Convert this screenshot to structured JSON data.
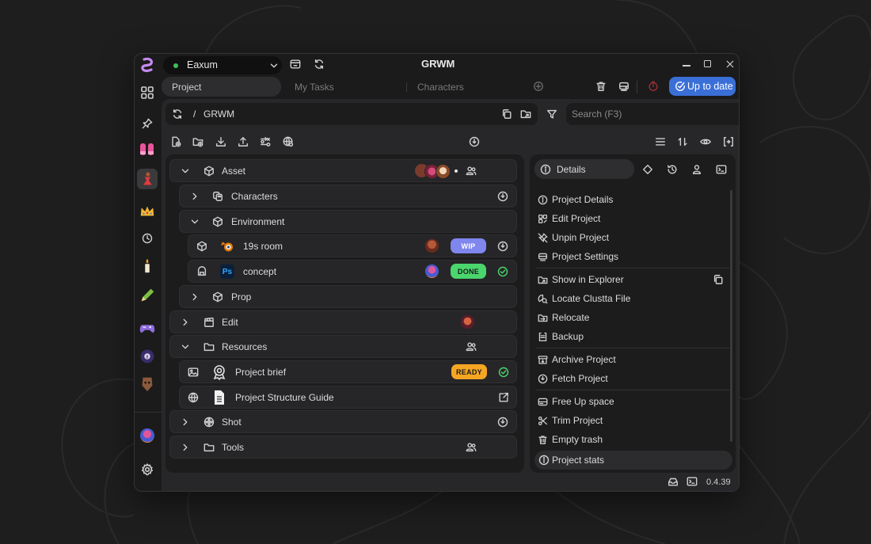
{
  "window": {
    "title": "GRWM",
    "workspace": "Eaxum",
    "status_color": "#3fbf5a"
  },
  "tabs": [
    {
      "label": "Project",
      "active": true
    },
    {
      "label": "My Tasks",
      "active": false
    },
    {
      "label": "Characters",
      "active": false
    }
  ],
  "status_button": {
    "label": "Up to date",
    "color": "#3a6fd8"
  },
  "path": {
    "separator": "/",
    "name": "GRWM"
  },
  "search": {
    "placeholder": "Search (F3)"
  },
  "tree": [
    {
      "label": "Asset",
      "icon": "cube-icon",
      "expanded": true
    },
    {
      "label": "Characters",
      "icon": "characters-icon",
      "expanded": false
    },
    {
      "label": "Environment",
      "icon": "cube-icon",
      "expanded": true
    },
    {
      "label": "19s room",
      "icon": "cube-icon",
      "app": "blender",
      "status": "WIP",
      "status_color": "#7f86ee"
    },
    {
      "label": "concept",
      "icon": "image-icon",
      "app": "Ps",
      "status": "DONE",
      "status_color": "#4ad66d"
    },
    {
      "label": "Prop",
      "icon": "cube-icon",
      "expanded": false
    },
    {
      "label": "Edit",
      "icon": "clapper-icon",
      "expanded": false
    },
    {
      "label": "Resources",
      "icon": "folder-icon",
      "expanded": true
    },
    {
      "label": "Project brief",
      "icon": "brief-icon",
      "status": "READY",
      "status_color": "#f5a623"
    },
    {
      "label": "Project Structure Guide",
      "icon": "doc-icon"
    },
    {
      "label": "Shot",
      "icon": "reel-icon",
      "expanded": false
    },
    {
      "label": "Tools",
      "icon": "folder-icon",
      "expanded": false
    }
  ],
  "details": {
    "tab_label": "Details",
    "menu": [
      "Project Details",
      "Edit Project",
      "Unpin Project",
      "Project Settings",
      "Show in Explorer",
      "Locate Clustta File",
      "Relocate",
      "Backup",
      "Archive Project",
      "Fetch Project",
      "Free Up space",
      "Trim Project",
      "Empty trash"
    ],
    "stats_label": "Project stats"
  },
  "footer": {
    "version": "0.4.39"
  }
}
